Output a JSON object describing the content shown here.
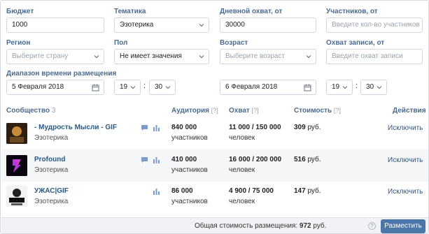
{
  "filters": {
    "budget": {
      "label": "Бюджет",
      "value": "1000"
    },
    "topic": {
      "label": "Тематика",
      "value": "Эзотерика"
    },
    "daily_reach": {
      "label": "Дневной охват, от",
      "value": "30000"
    },
    "members": {
      "label": "Участников, от",
      "placeholder": "Введите кол-во участников"
    },
    "region": {
      "label": "Регион",
      "placeholder": "Выберите страну"
    },
    "gender": {
      "label": "Пол",
      "value": "Не имеет значения"
    },
    "age": {
      "label": "Возраст",
      "placeholder": "Выберите возраст"
    },
    "post_reach": {
      "label": "Охват записи, от",
      "placeholder": "Введите охват записи"
    }
  },
  "time_range": {
    "label": "Диапазон времени размещения",
    "start": {
      "date": "5 Февраля 2018",
      "hour": "19",
      "minute": "30"
    },
    "end": {
      "date": "6 Февраля 2018",
      "hour": "19",
      "minute": "30"
    }
  },
  "table": {
    "headers": {
      "community": "Сообщество",
      "community_count": "3",
      "audience": "Аудитория",
      "reach": "Охват",
      "cost": "Стоимость",
      "actions": "Действия",
      "help": "[?]"
    },
    "rows": [
      {
        "name": "- Мудрость Мысли - GIF",
        "topic": "Эзотерика",
        "audience": "840 000",
        "audience_unit": "участников",
        "reach": "11 000 / 150 000",
        "reach_unit": "человек",
        "price": "309",
        "currency": "руб.",
        "action": "Исключить"
      },
      {
        "name": "Profound",
        "topic": "Эзотерика",
        "audience": "410 000",
        "audience_unit": "участников",
        "reach": "16 000 / 200 000",
        "reach_unit": "человек",
        "price": "516",
        "currency": "руб.",
        "action": "Исключить"
      },
      {
        "name": "УЖАС|GIF",
        "topic": "Эзотерика",
        "audience": "86 000",
        "audience_unit": "участников",
        "reach": "4 900 / 75 000",
        "reach_unit": "человек",
        "price": "147",
        "currency": "руб.",
        "action": "Исключить"
      }
    ]
  },
  "footer": {
    "total_label": "Общая стоимость размещения:",
    "total_value": "972",
    "currency": "руб.",
    "help": "?",
    "submit": "Разместить"
  },
  "colors": {
    "accent": "#4a76a8",
    "link": "#2a5885",
    "label": "#4a6b8f"
  }
}
